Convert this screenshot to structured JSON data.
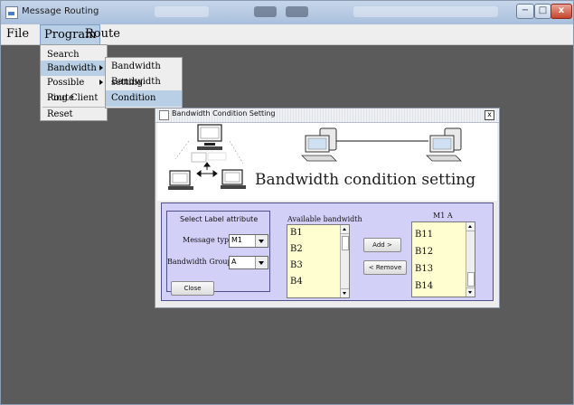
{
  "window": {
    "title": "Message Routing",
    "controls": {
      "minimize": "−",
      "maximize": "□",
      "close": "x"
    }
  },
  "menubar": {
    "items": [
      "File",
      "Program",
      "Route"
    ],
    "active": "Program"
  },
  "program_menu": {
    "items": [
      "Search",
      "Bandwidth",
      "Possible Route",
      "Ping Client",
      "Reset"
    ]
  },
  "bandwidth_submenu": {
    "items": [
      "Bandwidth setting",
      "Bandwidth update",
      "Condition"
    ],
    "highlighted": "Condition"
  },
  "dialog": {
    "title": "Bandwidth Condition Setting",
    "close_glyph": "x",
    "banner_heading": "Bandwidth condition setting",
    "label_box": {
      "heading": "Select Label attribute",
      "message_type_label": "Message type",
      "message_type_value": "M1",
      "bandwidth_group_label": "Bandwidth Group",
      "bandwidth_group_value": "A"
    },
    "close_button": "Close",
    "available": {
      "title": "Available bandwidth",
      "items": [
        "B1",
        "B2",
        "B3",
        "B4"
      ]
    },
    "add_button": "Add >",
    "remove_button": "< Remove",
    "selected": {
      "title": "M1  A",
      "items": [
        "B11",
        "B12",
        "B13",
        "B14"
      ]
    }
  },
  "colors": {
    "desktop": "#5b5b5b",
    "panel": "#d2d0f6",
    "list_bg": "#fffed0",
    "menu_highlight": "#b8cfe5"
  },
  "icons": [
    "app-icon",
    "computer-icon",
    "arrows-icon",
    "connection-line"
  ]
}
